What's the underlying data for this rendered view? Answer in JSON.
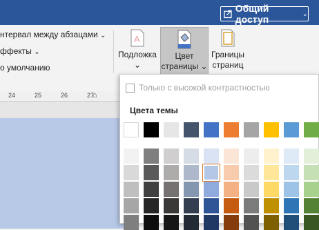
{
  "titlebar": {
    "share_label": "Общий доступ",
    "share_chevron": "⌄",
    "color": "#2b579a"
  },
  "ribbon": {
    "spacing_label": "нтервал между абзацами",
    "effects_label": "ффекты",
    "default_label": "о умолчанию",
    "watermark": {
      "line1": "Подложка",
      "line2": "⌄"
    },
    "page_color": {
      "line1": "Цвет",
      "line2": "страницы ⌄"
    },
    "page_borders": {
      "line1": "Границы",
      "line2": "страниц"
    }
  },
  "ruler": {
    "ticks": [
      "24",
      "25",
      "26",
      "27"
    ]
  },
  "dropdown": {
    "high_contrast_label": "Только с высокой контрастностью",
    "theme_colors_label": "Цвета темы",
    "theme_row": [
      "#ffffff",
      "#000000",
      "#e7e6e6",
      "#44546a",
      "#4472c4",
      "#ed7d31",
      "#a5a5a5",
      "#ffc000",
      "#5b9bd5",
      "#70ad47"
    ],
    "shade_rows": [
      [
        "#f2f2f2",
        "#7f7f7f",
        "#d0cece",
        "#d6dce5",
        "#dae3f3",
        "#fbe5d6",
        "#ededed",
        "#fff2cc",
        "#deebf7",
        "#e2f0d9"
      ],
      [
        "#d9d9d9",
        "#595959",
        "#aeabab",
        "#adb9ca",
        "#b4c7e7",
        "#f8cbad",
        "#dbdbdb",
        "#ffe699",
        "#bdd7ee",
        "#c5e0b4"
      ],
      [
        "#bfbfbf",
        "#404040",
        "#767171",
        "#8497b0",
        "#8faadc",
        "#f4b183",
        "#c9c9c9",
        "#ffd966",
        "#9dc3e6",
        "#a9d18e"
      ],
      [
        "#a6a6a6",
        "#262626",
        "#3b3838",
        "#333f50",
        "#2f5597",
        "#c55a11",
        "#7b7b7b",
        "#bf9000",
        "#2e75b6",
        "#548235"
      ],
      [
        "#7f7f7f",
        "#0d0d0d",
        "#171616",
        "#222a35",
        "#203864",
        "#843c0c",
        "#525252",
        "#7f6000",
        "#1f4e79",
        "#385723"
      ]
    ],
    "selected": "#b4c7e7"
  }
}
